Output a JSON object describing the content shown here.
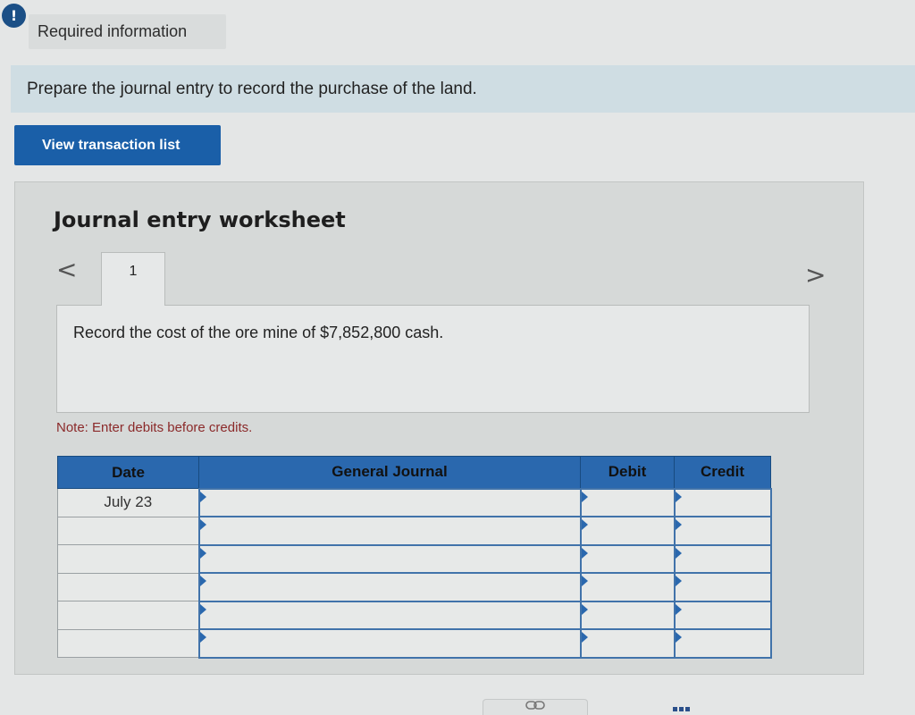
{
  "alert": {
    "icon": "exclamation-icon",
    "glyph": "!"
  },
  "required": {
    "label": "Required information"
  },
  "instruction": {
    "text": "Prepare the journal entry to record the purchase of the land."
  },
  "view_button": {
    "label": "View transaction list"
  },
  "worksheet": {
    "title": "Journal entry worksheet",
    "prev_glyph": "<",
    "next_glyph": ">",
    "tabs": [
      {
        "label": "1"
      }
    ],
    "description": "Record the cost of the ore mine of $7,852,800 cash.",
    "note": "Note: Enter debits before credits."
  },
  "journal": {
    "headers": {
      "date": "Date",
      "general_journal": "General Journal",
      "debit": "Debit",
      "credit": "Credit"
    },
    "rows": [
      {
        "date": "July 23",
        "account": "",
        "debit": "",
        "credit": ""
      },
      {
        "date": "",
        "account": "",
        "debit": "",
        "credit": ""
      },
      {
        "date": "",
        "account": "",
        "debit": "",
        "credit": ""
      },
      {
        "date": "",
        "account": "",
        "debit": "",
        "credit": ""
      },
      {
        "date": "",
        "account": "",
        "debit": "",
        "credit": ""
      },
      {
        "date": "",
        "account": "",
        "debit": "",
        "credit": ""
      }
    ]
  },
  "colors": {
    "accent_blue": "#1a5fa8",
    "header_blue": "#2a68ae",
    "instruction_bg": "#cfdde3",
    "note_red": "#8b2a2a"
  }
}
